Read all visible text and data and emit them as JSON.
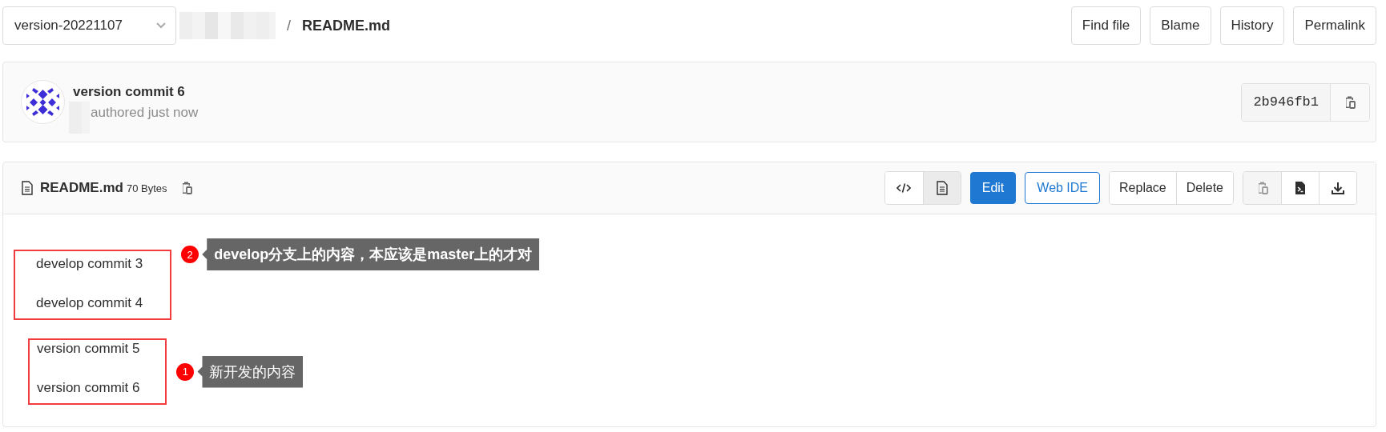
{
  "branch_selector": {
    "value": "version-20221107"
  },
  "breadcrumb": {
    "separator": "/",
    "file": "README.md"
  },
  "header_buttons": [
    "Find file",
    "Blame",
    "History",
    "Permalink"
  ],
  "commit": {
    "title": "version commit 6",
    "meta": "authored just now",
    "sha": "2b946fb1"
  },
  "file": {
    "name": "README.md",
    "size": "70 Bytes",
    "view_modes": [
      {
        "kind": "source",
        "selected": false
      },
      {
        "kind": "rendered",
        "selected": true
      }
    ],
    "actions": [
      {
        "label": "Edit",
        "kind": "primary"
      },
      {
        "label": "Web IDE",
        "kind": "outline"
      }
    ],
    "action_group": [
      "Replace",
      "Delete"
    ],
    "tool_buttons": [
      {
        "kind": "copy",
        "disabled": true
      },
      {
        "kind": "raw",
        "disabled": false
      },
      {
        "kind": "download",
        "disabled": false
      }
    ]
  },
  "content": {
    "groups": [
      {
        "lines": [
          "develop commit 3",
          "develop commit 4"
        ],
        "annotation": {
          "number": "2",
          "text": "develop分支上的内容，本应该是master上的才对",
          "bold": true
        }
      },
      {
        "lines": [
          "version commit 5",
          "version commit 6"
        ],
        "annotation": {
          "number": "1",
          "text": "新开发的内容",
          "bold": false
        }
      }
    ]
  }
}
